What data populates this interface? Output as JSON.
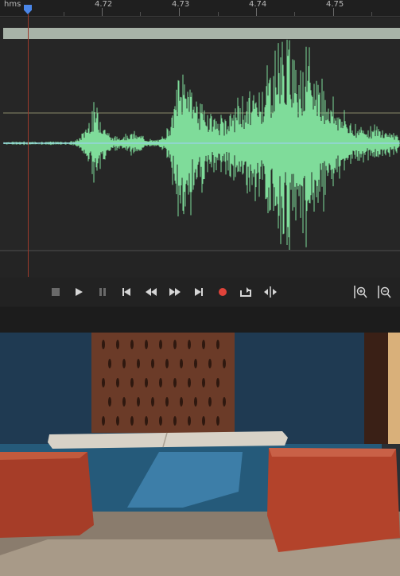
{
  "ruler": {
    "unit_label": "hms",
    "ticks": [
      "4.72",
      "4.73",
      "4.74",
      "4.75"
    ]
  },
  "transport": {
    "buttons": [
      {
        "name": "stop-button",
        "icon": "stop-icon"
      },
      {
        "name": "play-button",
        "icon": "play-icon"
      },
      {
        "name": "pause-button",
        "icon": "pause-icon"
      },
      {
        "name": "skip-to-start-button",
        "icon": "skip-back-icon"
      },
      {
        "name": "rewind-button",
        "icon": "rewind-icon"
      },
      {
        "name": "fast-forward-button",
        "icon": "fast-forward-icon"
      },
      {
        "name": "skip-to-end-button",
        "icon": "skip-forward-icon"
      },
      {
        "name": "record-button",
        "icon": "record-icon"
      },
      {
        "name": "loop-button",
        "icon": "loop-icon"
      },
      {
        "name": "skip-selection-button",
        "icon": "skip-selection-icon"
      }
    ],
    "zoom": [
      {
        "name": "zoom-in-amplitude-button",
        "icon": "zoom-in-icon"
      },
      {
        "name": "zoom-out-amplitude-button",
        "icon": "zoom-out-icon"
      }
    ]
  },
  "colors": {
    "waveform": "#7fdc9a",
    "region": "#a8b3a8",
    "playhead": "#4a86e8",
    "record": "#e0433a",
    "background": "#202020"
  },
  "photo": {
    "content": "brick on cracked slab between two bricks"
  }
}
